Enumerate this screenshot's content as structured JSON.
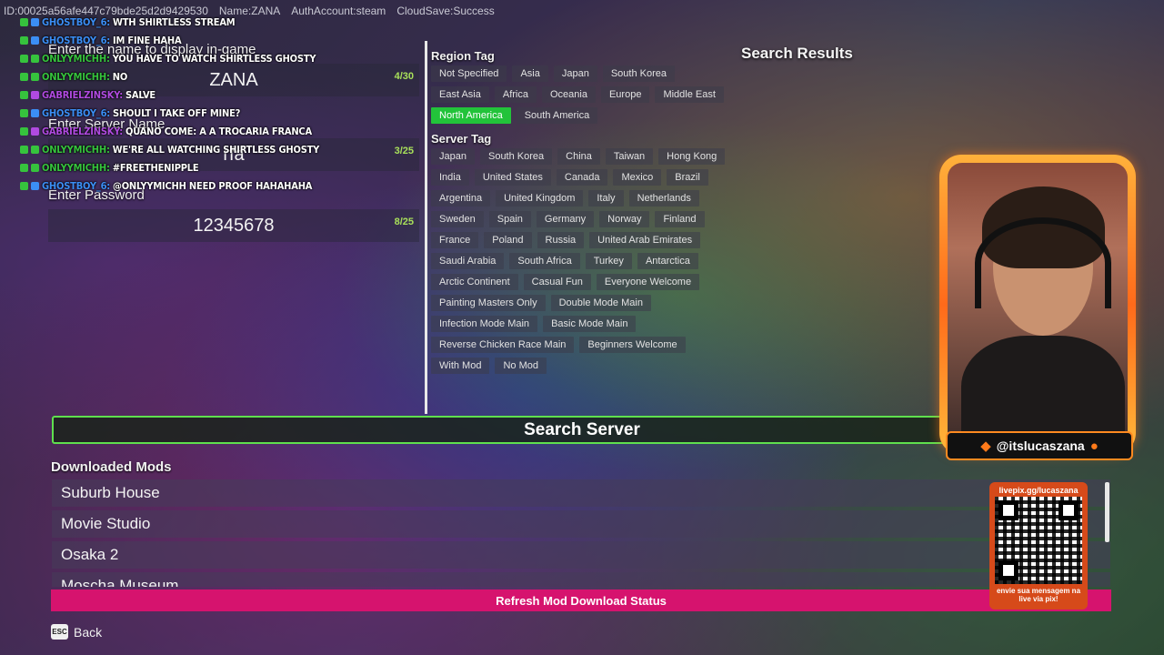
{
  "info_bar": {
    "id": "ID:00025a56afe447c79bde25d2d9429530",
    "name": "Name:ZANA",
    "auth": "AuthAccount:steam",
    "cloud": "CloudSave:Success"
  },
  "chat": [
    {
      "user": "GHOSTBOY_6:",
      "msg": "WTH SHIRTLESS STREAM",
      "color": "#3b8ef5"
    },
    {
      "user": "GHOSTBOY_6:",
      "msg": "IM FINE HAHA",
      "color": "#3b8ef5"
    },
    {
      "user": "ONLYYMICHH:",
      "msg": "YOU HAVE TO WATCH SHIRTLESS GHOSTY",
      "color": "#36c33d"
    },
    {
      "user": "ONLYYMICHH:",
      "msg": "NO",
      "color": "#36c33d"
    },
    {
      "user": "GABRIELZINSKY:",
      "msg": "SALVE",
      "color": "#b04ae0"
    },
    {
      "user": "GHOSTBOY_6:",
      "msg": "SHOULT I TAKE OFF MINE?",
      "color": "#3b8ef5"
    },
    {
      "user": "GABRIELZINSKY:",
      "msg": "QUANO COME: A A TROCARIA FRANCA",
      "color": "#b04ae0"
    },
    {
      "user": "ONLYYMICHH:",
      "msg": "WE'RE ALL WATCHING SHIRTLESS GHOSTY",
      "color": "#36c33d"
    },
    {
      "user": "ONLYYMICHH:",
      "msg": "#FREETHENIPPLE",
      "color": "#36c33d"
    },
    {
      "user": "GHOSTBOY_6:",
      "msg": "@ONLYYMICHH NEED PROOF HAHAHAHA",
      "color": "#3b8ef5"
    }
  ],
  "form": {
    "name_label": "Enter the name to display in-game",
    "name_value": "ZANA",
    "name_count": "4/30",
    "server_label": "Enter Server Name",
    "server_value": "rfa",
    "server_count": "3/25",
    "password_label": "Enter Password",
    "password_value": "12345678",
    "password_count": "8/25"
  },
  "region_tag": {
    "title": "Region Tag",
    "tags": [
      "Not Specified",
      "Asia",
      "Japan",
      "South Korea",
      "East Asia",
      "Africa",
      "Oceania",
      "Europe",
      "Middle East",
      "North America",
      "South America"
    ],
    "active": "North America"
  },
  "server_tag": {
    "title": "Server Tag",
    "tags": [
      "Japan",
      "South Korea",
      "China",
      "Taiwan",
      "Hong Kong",
      "India",
      "United States",
      "Canada",
      "Mexico",
      "Brazil",
      "Argentina",
      "United Kingdom",
      "Italy",
      "Netherlands",
      "Sweden",
      "Spain",
      "Germany",
      "Norway",
      "Finland",
      "France",
      "Poland",
      "Russia",
      "United Arab Emirates",
      "Saudi Arabia",
      "South Africa",
      "Turkey",
      "Antarctica",
      "Arctic Continent",
      "Casual Fun",
      "Everyone Welcome",
      "Painting Masters Only",
      "Double Mode Main",
      "Infection Mode Main",
      "Basic Mode Main",
      "Reverse Chicken Race Main",
      "Beginners Welcome",
      "With Mod",
      "No Mod"
    ]
  },
  "results_title": "Search Results",
  "search_button": "Search Server",
  "mods": {
    "title": "Downloaded Mods",
    "items": [
      "Suburb House",
      "Movie Studio",
      "Osaka 2",
      "Moscha Museum"
    ]
  },
  "refresh_button": "Refresh Mod Download Status",
  "back": {
    "key": "ESC",
    "label": "Back"
  },
  "overlay": {
    "handle": "@itslucaszana",
    "qr_top": "livepix.gg/lucaszana",
    "qr_bottom": "envie sua mensagem na live via pix!"
  },
  "colors": {
    "accent_green": "#22c33a",
    "search_border": "#5fe04e",
    "refresh_pink": "#d6136e",
    "counter_green": "#a8e05a"
  }
}
